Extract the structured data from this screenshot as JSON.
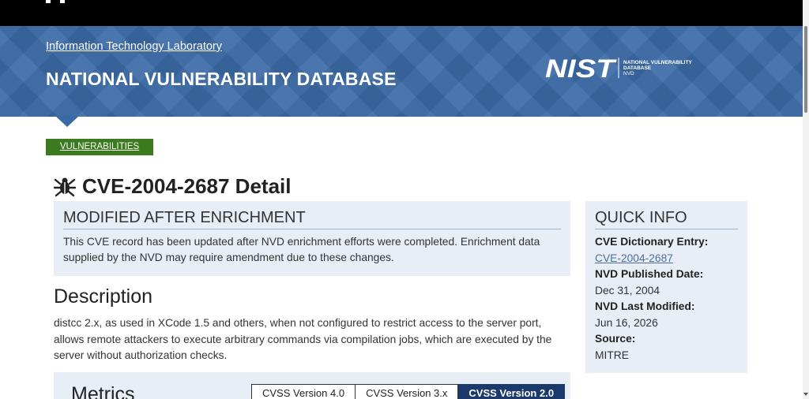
{
  "header": {
    "itl_link": "Information Technology Laboratory",
    "site_title": "NATIONAL VULNERABILITY DATABASE",
    "nist_logo_text": "NIST",
    "nist_sub_line1": "NATIONAL VULNERABILITY",
    "nist_sub_line2": "DATABASE",
    "nist_sub_line3": "NVD",
    "banner_color": "#3a6aa6"
  },
  "nav": {
    "vulnerabilities_tab": "VULNERABILITIES",
    "tab_color": "#3b7a1e"
  },
  "page": {
    "title": "CVE-2004-2687 Detail",
    "title_icon": "bug-icon"
  },
  "modified_notice": {
    "heading": "MODIFIED AFTER ENRICHMENT",
    "text": "This CVE record has been updated after NVD enrichment efforts were completed. Enrichment data supplied by the NVD may require amendment due to these changes."
  },
  "description": {
    "heading": "Description",
    "text": "distcc 2.x, as used in XCode 1.5 and others, when not configured to restrict access to the server port, allows remote attackers to execute arbitrary commands via compilation jobs, which are executed by the server without authorization checks."
  },
  "metrics": {
    "heading": "Metrics",
    "tabs": [
      "CVSS Version 4.0",
      "CVSS Version 3.x",
      "CVSS Version 2.0"
    ],
    "active_tab": "CVSS Version 2.0",
    "active_color": "#1b3a6b"
  },
  "quick_info": {
    "heading": "QUICK INFO",
    "cve_entry_label": "CVE Dictionary Entry:",
    "cve_entry_value": "CVE-2004-2687",
    "published_label": "NVD Published Date:",
    "published_value": "Dec 31, 2004",
    "modified_label": "NVD Last Modified:",
    "modified_value": "Jun 16, 2026",
    "source_label": "Source:",
    "source_value": "MITRE"
  }
}
